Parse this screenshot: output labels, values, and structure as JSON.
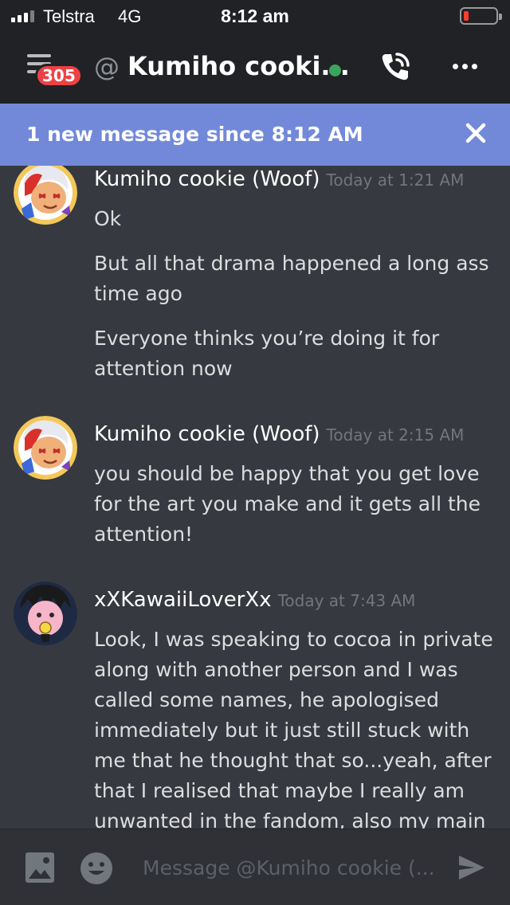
{
  "status_bar": {
    "carrier": "Telstra",
    "network": "4G",
    "time": "8:12 am",
    "battery_percent": 10
  },
  "header": {
    "unread_badge": "305",
    "at_symbol": "@",
    "dm_name": "Kumiho cooki...",
    "presence": "online",
    "icons": [
      "menu-icon",
      "phone-call-icon",
      "more-icon"
    ]
  },
  "banner": {
    "text": "1 new message since 8:12 AM",
    "icon": "close-icon"
  },
  "messages": [
    {
      "author": "Kumiho cookie (Woof)",
      "timestamp": "Today at 1:21 AM",
      "lines": [
        "Ok",
        "But all that drama happened a long ass time ago",
        "Everyone thinks you’re doing it for attention now"
      ]
    },
    {
      "author": "Kumiho cookie (Woof)",
      "timestamp": "Today at 2:15 AM",
      "lines": [
        "you should be happy that you get love for the art you make and it gets all the attention!"
      ]
    },
    {
      "author": "xXKawaiiLoverXx",
      "timestamp": "Today at 7:43 AM",
      "lines": [
        "Look, I was speaking to cocoa in private along with another person and I was called some names, he apologised immediately but it just still stuck with me that he thought that so...yeah, after that I realised that maybe I really am unwanted in the fandom, also my main"
      ]
    }
  ],
  "composer": {
    "placeholder": "Message @Kumiho cookie (...",
    "icons": [
      "image-icon",
      "emoji-icon",
      "send-icon"
    ]
  },
  "colors": {
    "background": "#36393f",
    "header": "#202225",
    "banner": "#7289da",
    "badge": "#ed4245",
    "online": "#3ba55d",
    "timestamp": "#72767d"
  }
}
